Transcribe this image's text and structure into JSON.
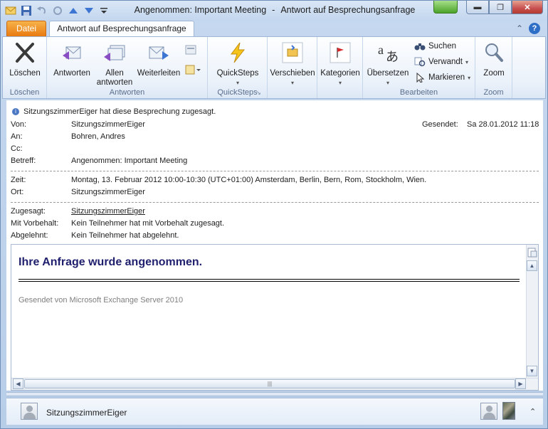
{
  "window": {
    "title_subject": "Angenommen: Important Meeting",
    "title_separator": "-",
    "title_app": "Antwort auf Besprechungsanfrage",
    "close_glyph": "✕",
    "min_glyph": "▬",
    "max_glyph": "❐"
  },
  "tabs": {
    "file": "Datei",
    "main": "Antwort auf Besprechungsanfrage",
    "help": "?",
    "collapse_glyph": "⌃"
  },
  "ribbon": {
    "groups": {
      "delete": "Löschen",
      "respond": "Antworten",
      "quicksteps": "QuickSteps",
      "edit": "Bearbeiten",
      "zoom": "Zoom"
    },
    "buttons": {
      "delete": "Löschen",
      "reply": "Antworten",
      "reply_all_1": "Allen",
      "reply_all_2": "antworten",
      "forward": "Weiterleiten",
      "quicksteps": "QuickSteps",
      "move": "Verschieben",
      "categories": "Kategorien",
      "translate": "Übersetzen",
      "find": "Suchen",
      "related": "Verwandt",
      "select": "Markieren",
      "zoom": "Zoom"
    }
  },
  "message": {
    "info": "SitzungszimmerEiger hat diese Besprechung zugesagt.",
    "labels": {
      "from": "Von:",
      "to": "An:",
      "cc": "Cc:",
      "subject": "Betreff:",
      "sent": "Gesendet:",
      "time": "Zeit:",
      "location": "Ort:",
      "accepted": "Zugesagt:",
      "tentative": "Mit Vorbehalt:",
      "declined": "Abgelehnt:"
    },
    "from": "SitzungszimmerEiger",
    "to": "Bohren, Andres",
    "cc": "",
    "subject": "Angenommen: Important Meeting",
    "sent": "Sa 28.01.2012 11:18",
    "time": "Montag, 13. Februar 2012 10:00-10:30 (UTC+01:00) Amsterdam, Berlin, Bern, Rom, Stockholm, Wien.",
    "location": "SitzungszimmerEiger",
    "accepted": "SitzungszimmerEiger",
    "tentative": "Kein Teilnehmer hat mit Vorbehalt zugesagt.",
    "declined": "Kein Teilnehmer hat abgelehnt."
  },
  "body": {
    "heading": "Ihre Anfrage wurde angenommen.",
    "footer": "Gesendet von Microsoft Exchange Server 2010"
  },
  "people": {
    "name": "SitzungszimmerEiger"
  },
  "colors": {
    "accent": "#e87b10",
    "heading": "#1f1f6e"
  }
}
